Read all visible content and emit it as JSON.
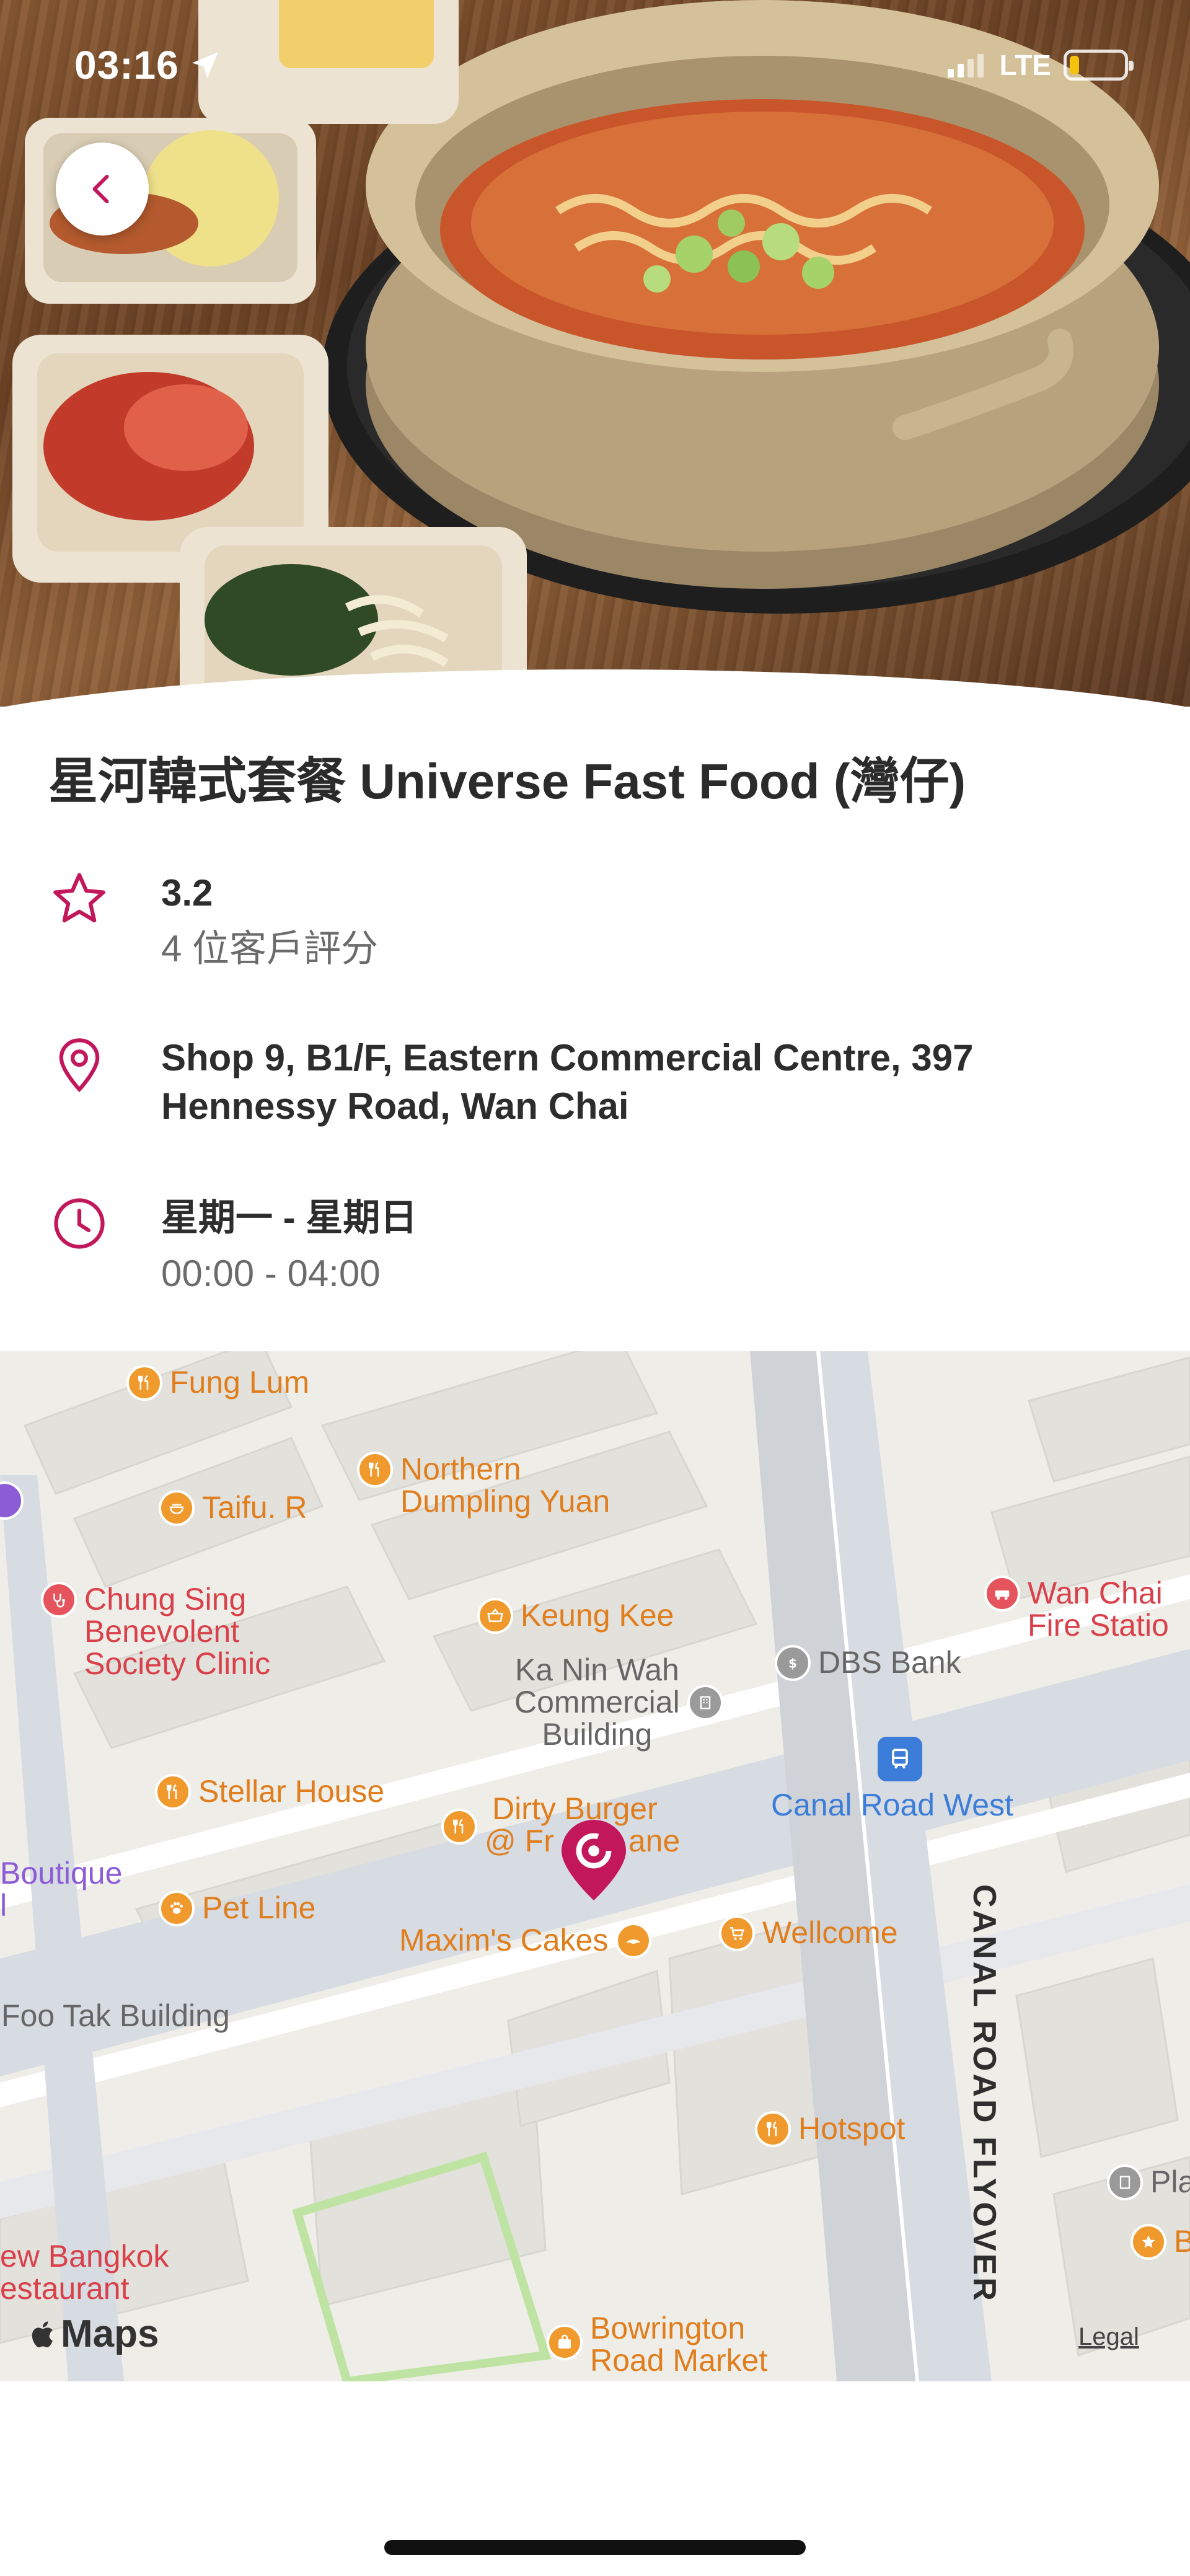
{
  "status_bar": {
    "time": "03:16",
    "network": "LTE",
    "battery_level": 0.18
  },
  "restaurant": {
    "name": "星河韓式套餐 Universe Fast Food (灣仔)",
    "rating": {
      "value": "3.2",
      "reviews": "4 位客戶評分",
      "icon": "star-outline-icon"
    },
    "address": {
      "line1": "Shop 9, B1/F, Eastern Commercial Centre, 397",
      "line2": "Hennessy Road, Wan Chai",
      "icon": "location-pin-icon"
    },
    "hours": {
      "days": "星期一 - 星期日",
      "time": "00:00 - 04:00",
      "icon": "clock-icon"
    }
  },
  "colors": {
    "accent": "#c2185b",
    "poi_orange": "#e07e1e",
    "poi_red": "#d9404a",
    "transit_blue": "#3c7dd9"
  },
  "map": {
    "logo": "Maps",
    "legal": "Legal",
    "pois": {
      "fung_lum": "Fung Lum",
      "northern_1": "Northern",
      "northern_2": "Dumpling Yuan",
      "taifu": "Taifu. R",
      "chung_sing_1": "Chung Sing",
      "chung_sing_2": "Benevolent",
      "chung_sing_3": "Society Clinic",
      "keung_kee": "Keung Kee",
      "wan_chai_fire_1": "Wan Chai",
      "wan_chai_fire_2": "Fire Statio",
      "ka_nin_wah_1": "Ka Nin Wah",
      "ka_nin_wah_2": "Commercial",
      "ka_nin_wah_3": "Building",
      "dbs": "DBS Bank",
      "canal_road_west": "Canal Road West",
      "stellar": "Stellar House",
      "dirty_burger_1": "Dirty Burger",
      "dirty_burger_2": "@ Fr",
      "dirty_burger_3": "ane",
      "boutique_1": "Boutique",
      "boutique_2": "l",
      "pet_line": "Pet Line",
      "maxims": "Maxim's Cakes",
      "wellcome": "Wellcome",
      "foo_tak": "Foo Tak Building",
      "hotspot": "Hotspot",
      "pla": "Pla",
      "b_cut": "B",
      "bangkok_1": "ew Bangkok",
      "bangkok_2": "estaurant",
      "bowrington_1": "Bowrington",
      "bowrington_2": "Road Market",
      "canal_flyover": "CANAL ROAD FLYOVER"
    }
  }
}
